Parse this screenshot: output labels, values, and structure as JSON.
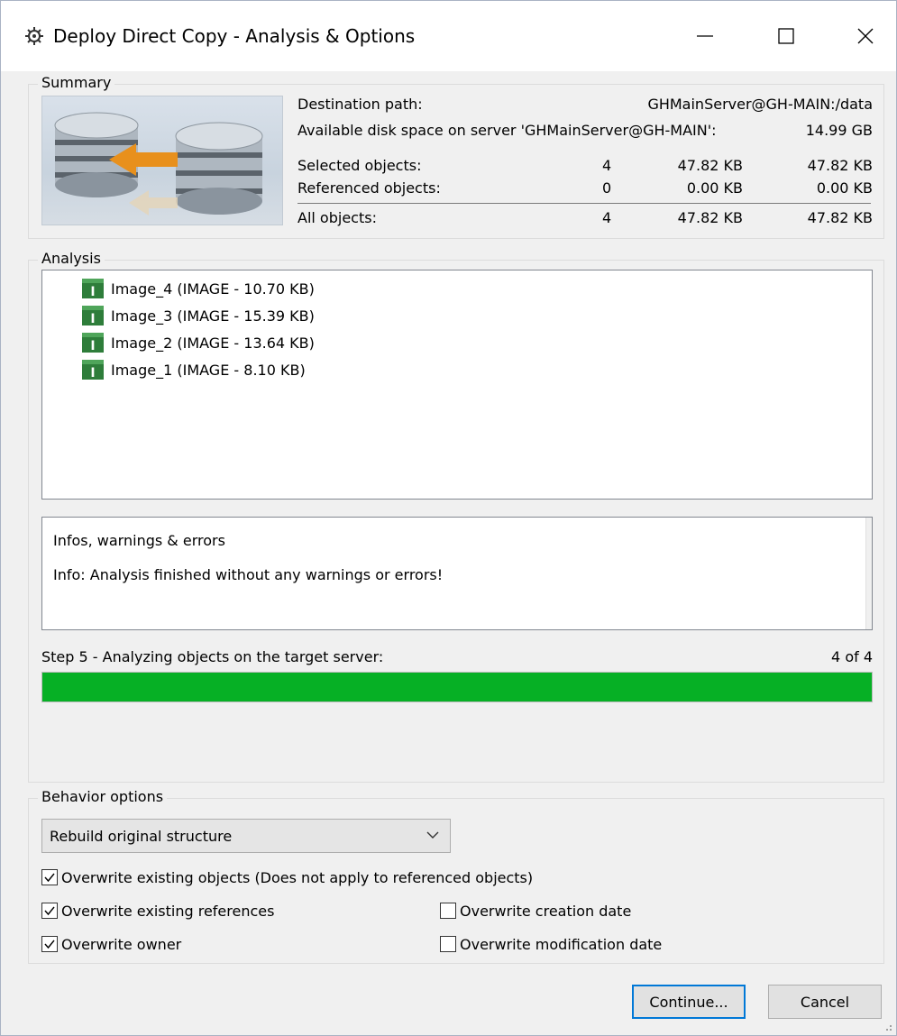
{
  "window": {
    "title": "Deploy Direct Copy - Analysis & Options"
  },
  "summary": {
    "label": "Summary",
    "destination_label": "Destination path:",
    "destination_value": "GHMainServer@GH-MAIN:/data",
    "space_label": "Available disk space on server 'GHMainServer@GH-MAIN':",
    "space_value": "14.99 GB",
    "rows": [
      {
        "label": "Selected objects:",
        "count": "4",
        "size": "47.82 KB",
        "total": "47.82 KB"
      },
      {
        "label": "Referenced objects:",
        "count": "0",
        "size": "0.00 KB",
        "total": "0.00 KB"
      },
      {
        "label": "All objects:",
        "count": "4",
        "size": "47.82 KB",
        "total": "47.82 KB"
      }
    ]
  },
  "analysis": {
    "label": "Analysis",
    "items": [
      "Image_4 (IMAGE - 10.70 KB)",
      "Image_3 (IMAGE - 15.39 KB)",
      "Image_2 (IMAGE - 13.64 KB)",
      "Image_1 (IMAGE - 8.10 KB)"
    ],
    "infos_title": "Infos, warnings & errors",
    "infos_message": "Info: Analysis finished without any warnings or errors!",
    "step_label": "Step 5 - Analyzing objects on the target server:",
    "step_count": "4 of 4",
    "progress": 1.0
  },
  "behavior": {
    "label": "Behavior options",
    "structure_selected": "Rebuild original structure",
    "options": {
      "overwrite_objects": {
        "label": "Overwrite existing objects (Does not apply to referenced objects)",
        "checked": true
      },
      "overwrite_references": {
        "label": "Overwrite existing references",
        "checked": true
      },
      "overwrite_owner": {
        "label": "Overwrite owner",
        "checked": true
      },
      "overwrite_creation_date": {
        "label": "Overwrite creation date",
        "checked": false
      },
      "overwrite_modification_date": {
        "label": "Overwrite modification date",
        "checked": false
      }
    }
  },
  "buttons": {
    "continue": "Continue...",
    "cancel": "Cancel"
  },
  "colors": {
    "progress": "#06b025",
    "focus": "#0078d7",
    "icon_green": "#2e7d3a"
  }
}
